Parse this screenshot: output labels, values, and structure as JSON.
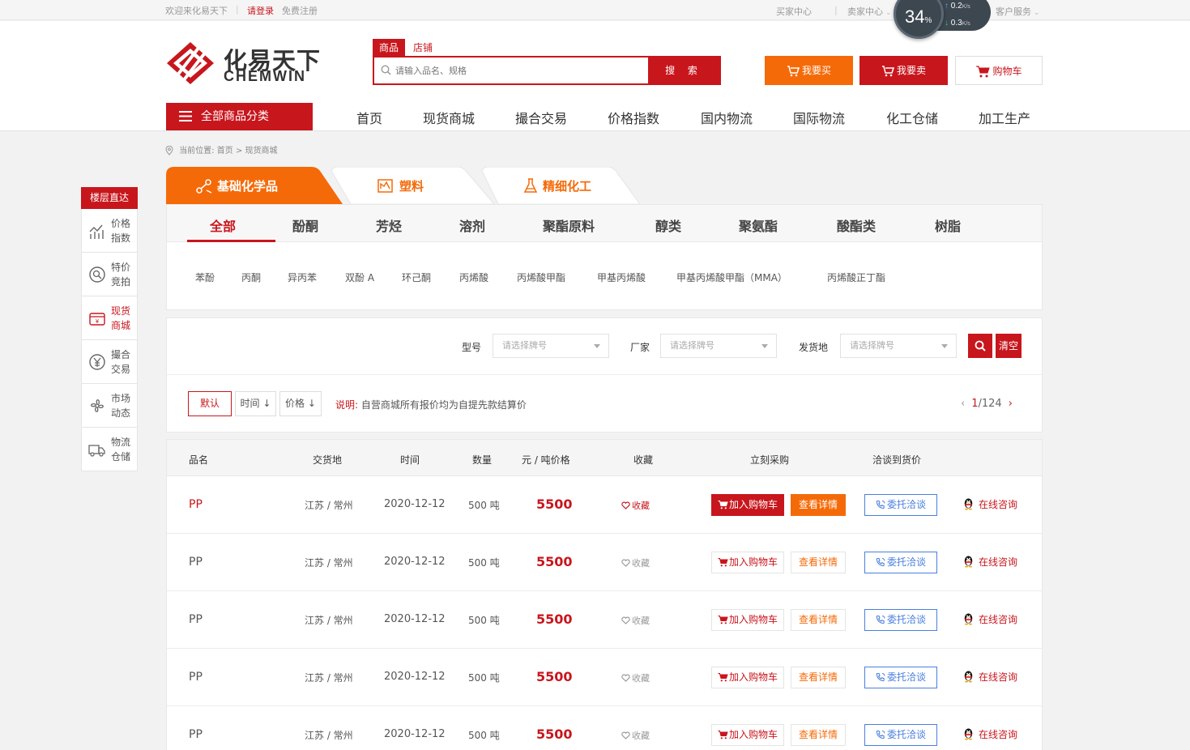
{
  "topbar": {
    "welcome": "欢迎来化易天下",
    "login": "请登录",
    "register": "免费注册",
    "buyer_center": "买家中心",
    "seller_center": "卖家中心",
    "customer_service": "客户服务"
  },
  "speed_widget": {
    "percent": "34",
    "percent_unit": "%",
    "upload": "0.2",
    "download": "0.3",
    "unit": "K/s"
  },
  "logo": {
    "cn": "化易天下",
    "en": "CHEMWIN"
  },
  "search": {
    "tabs": [
      "商品",
      "店铺"
    ],
    "placeholder": "请输入品名、规格",
    "button": "搜 索"
  },
  "header_buttons": {
    "buy": "我要买",
    "sell": "我要卖",
    "cart": "购物车"
  },
  "all_categories": "全部商品分类",
  "nav": [
    "首页",
    "现货商城",
    "撮合交易",
    "价格指数",
    "国内物流",
    "国际物流",
    "化工仓储",
    "加工生产"
  ],
  "breadcrumb": {
    "label": "当前位置:",
    "home": "首页",
    "sep": ">",
    "current": "现货商城"
  },
  "floor_nav": {
    "title": "楼层直达",
    "items": [
      {
        "line1": "价格",
        "line2": "指数",
        "icon": "chart-icon"
      },
      {
        "line1": "特价",
        "line2": "竞拍",
        "icon": "auction-icon"
      },
      {
        "line1": "现货",
        "line2": "商城",
        "icon": "shop-icon"
      },
      {
        "line1": "撮合",
        "line2": "交易",
        "icon": "yen-icon"
      },
      {
        "line1": "市场",
        "line2": "动态",
        "icon": "fan-icon"
      },
      {
        "line1": "物流",
        "line2": "仓储",
        "icon": "truck-icon"
      }
    ]
  },
  "main_tabs": [
    "基础化学品",
    "塑料",
    "精细化工"
  ],
  "sub_categories": [
    "全部",
    "酚酮",
    "芳烃",
    "溶剂",
    "聚酯原料",
    "醇类",
    "聚氨酯",
    "酸酯类",
    "树脂"
  ],
  "products": [
    "苯酚",
    "丙酮",
    "异丙苯",
    "双酚 A",
    "环己酮",
    "丙烯酸",
    "丙烯酸甲酯",
    "甲基丙烯酸",
    "甲基丙烯酸甲酯（MMA）",
    "丙烯酸正丁酯"
  ],
  "filters": {
    "model_label": "型号",
    "maker_label": "厂家",
    "origin_label": "发货地",
    "select_placeholder": "请选择牌号",
    "clear": "清空"
  },
  "sort": {
    "default": "默认",
    "time": "时间",
    "price": "价格",
    "arrow": "↓"
  },
  "note": {
    "label": "说明:",
    "text": "自营商城所有报价均为自提先款结算价"
  },
  "pager": {
    "current": "1",
    "sep": "/",
    "total": "124"
  },
  "table": {
    "headers": [
      "品名",
      "交货地",
      "时间",
      "数量",
      "元 / 吨价格",
      "收藏",
      "立刻采购",
      "洽谈到货价"
    ],
    "actions": {
      "favorite": "收藏",
      "add_cart": "加入购物车",
      "details": "查看详情",
      "entrust": "委托洽谈",
      "consult": "在线咨询"
    },
    "rows": [
      {
        "name": "PP",
        "place": "江苏 / 常州",
        "time": "2020-12-12",
        "qty": "500 吨",
        "price": "5500"
      },
      {
        "name": "PP",
        "place": "江苏 / 常州",
        "time": "2020-12-12",
        "qty": "500 吨",
        "price": "5500"
      },
      {
        "name": "PP",
        "place": "江苏 / 常州",
        "time": "2020-12-12",
        "qty": "500 吨",
        "price": "5500"
      },
      {
        "name": "PP",
        "place": "江苏 / 常州",
        "time": "2020-12-12",
        "qty": "500 吨",
        "price": "5500"
      },
      {
        "name": "PP",
        "place": "江苏 / 常州",
        "time": "2020-12-12",
        "qty": "500 吨",
        "price": "5500"
      }
    ]
  },
  "colors": {
    "brand_red": "#c8161d",
    "accent_orange": "#f56a08",
    "link_blue": "#4a7fe0"
  }
}
